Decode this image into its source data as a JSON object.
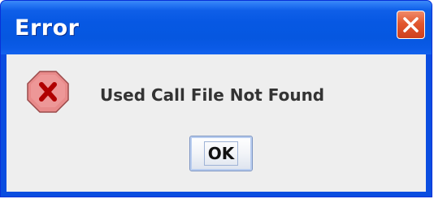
{
  "window": {
    "title": "Error",
    "close_icon": "close-x-icon"
  },
  "dialog": {
    "icon": "error-stop-icon",
    "message": "Used Call File Not Found",
    "ok_label": "OK"
  },
  "colors": {
    "title_bar": "#0758e3",
    "client_background": "#eeeeee",
    "close_button": "#e2572f",
    "error_icon": "#e88a8a"
  }
}
